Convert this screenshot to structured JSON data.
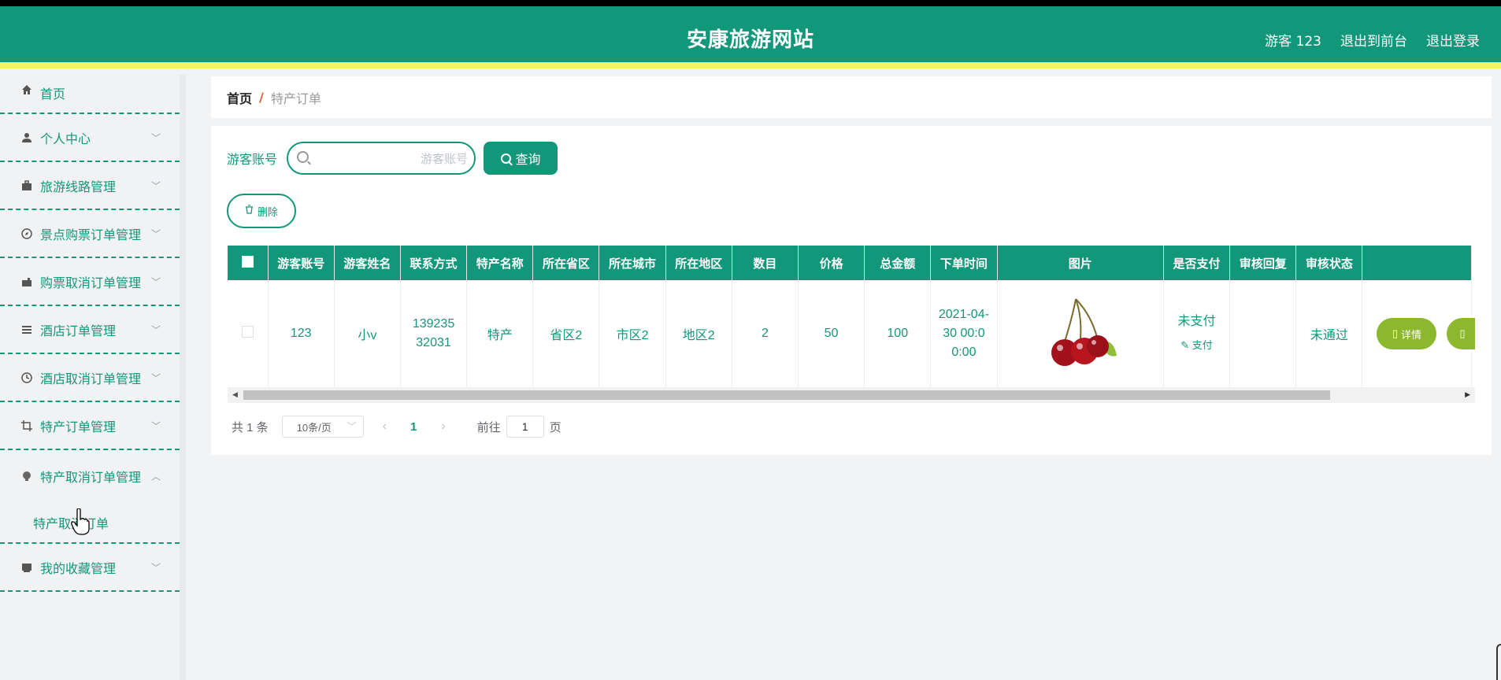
{
  "header": {
    "title": "安康旅游网站",
    "user": "游客 123",
    "to_front": "退出到前台",
    "logout": "退出登录"
  },
  "sidebar": {
    "items": [
      {
        "label": "首页",
        "icon": "home-icon"
      },
      {
        "label": "个人中心",
        "icon": "user-icon"
      },
      {
        "label": "旅游线路管理",
        "icon": "briefcase-icon"
      },
      {
        "label": "景点购票订单管理",
        "icon": "compass-icon"
      },
      {
        "label": "购票取消订单管理",
        "icon": "suitcase-icon"
      },
      {
        "label": "酒店订单管理",
        "icon": "list-icon"
      },
      {
        "label": "酒店取消订单管理",
        "icon": "clock-icon"
      },
      {
        "label": "特产订单管理",
        "icon": "crop-icon"
      },
      {
        "label": "特产取消订单管理",
        "icon": "bulb-icon",
        "expanded": true
      },
      {
        "label": "我的收藏管理",
        "icon": "box-icon"
      }
    ],
    "submenu": "特产取消订单"
  },
  "breadcrumb": {
    "home": "首页",
    "separator": "/",
    "current": "特产订单"
  },
  "search": {
    "label": "游客账号",
    "placeholder": "游客账号",
    "value": "",
    "button": "查询"
  },
  "actions": {
    "delete": "删除"
  },
  "table": {
    "headers": [
      "游客账号",
      "游客姓名",
      "联系方式",
      "特产名称",
      "所在省区",
      "所在城市",
      "所在地区",
      "数目",
      "价格",
      "总金额",
      "下单时间",
      "图片",
      "是否支付",
      "审核回复",
      "审核状态",
      ""
    ],
    "rows": [
      {
        "account": "123",
        "name": "小v",
        "phone": "13923532031",
        "product": "特产",
        "province": "省区2",
        "city": "市区2",
        "district": "地区2",
        "quantity": "2",
        "price": "50",
        "total": "100",
        "order_time": "2021-04-30 00:00:00",
        "image": "cherry-image",
        "paid": "未支付",
        "pay_link": "支付",
        "reply": "",
        "status": "未通过",
        "ops": [
          "详情"
        ]
      }
    ]
  },
  "pagination": {
    "total": "共 1 条",
    "page_size": "10条/页",
    "current": "1",
    "goto_label": "前往",
    "goto_value": "1",
    "page_unit": "页"
  },
  "colors": {
    "primary": "#13977a",
    "accent": "#f4f45a",
    "op_button": "#8bb82d"
  }
}
